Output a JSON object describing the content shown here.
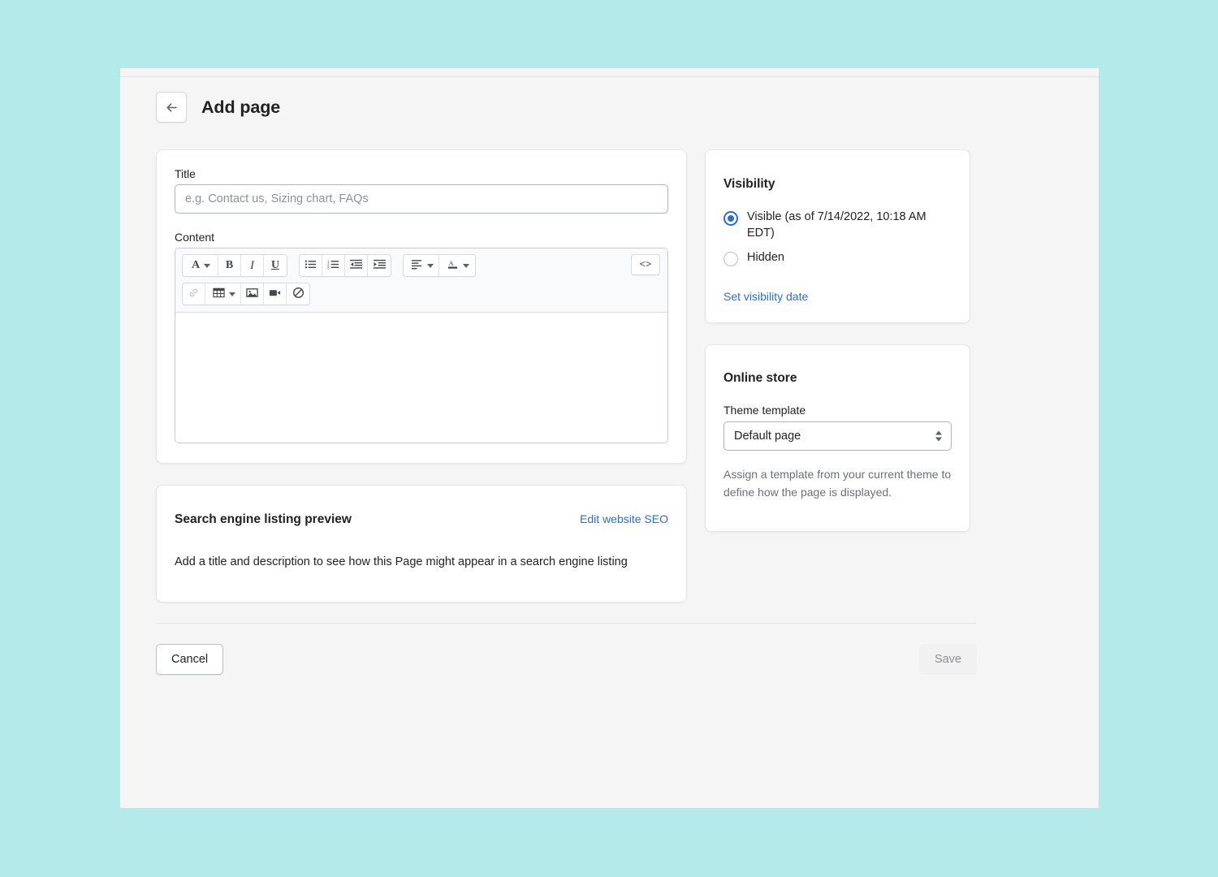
{
  "header": {
    "back_icon": "arrow-left-icon",
    "title": "Add page"
  },
  "form": {
    "title_label": "Title",
    "title_value": "",
    "title_placeholder": "e.g. Contact us, Sizing chart, FAQs",
    "content_label": "Content",
    "content_value": ""
  },
  "editor_toolbar": {
    "row1": [
      {
        "name": "font-format-button",
        "glyph": "A",
        "style": "serifA",
        "caret": true,
        "disabled": false
      },
      {
        "name": "bold-button",
        "glyph": "B",
        "style": "bold",
        "caret": false,
        "disabled": false
      },
      {
        "name": "italic-button",
        "glyph": "I",
        "style": "ital",
        "caret": false,
        "disabled": false
      },
      {
        "name": "underline-button",
        "glyph": "U",
        "style": "und",
        "caret": false,
        "disabled": false
      },
      {
        "name": "bulleted-list-button",
        "glyph": "bulleted-list-icon",
        "style": "icon",
        "caret": false,
        "disabled": false
      },
      {
        "name": "numbered-list-button",
        "glyph": "numbered-list-icon",
        "style": "icon",
        "caret": false,
        "disabled": false
      },
      {
        "name": "outdent-button",
        "glyph": "outdent-icon",
        "style": "icon",
        "caret": false,
        "disabled": false
      },
      {
        "name": "indent-button",
        "glyph": "indent-icon",
        "style": "icon",
        "caret": false,
        "disabled": false
      },
      {
        "name": "align-button",
        "glyph": "align-left-icon",
        "style": "icon",
        "caret": true,
        "disabled": false
      },
      {
        "name": "text-color-button",
        "glyph": "text-color-icon",
        "style": "icon",
        "caret": true,
        "disabled": false
      }
    ],
    "row2": [
      {
        "name": "insert-link-button",
        "glyph": "link-icon",
        "style": "icon",
        "caret": false,
        "disabled": true
      },
      {
        "name": "insert-table-button",
        "glyph": "table-icon",
        "style": "icon",
        "caret": true,
        "disabled": false
      },
      {
        "name": "insert-image-button",
        "glyph": "image-icon",
        "style": "icon",
        "caret": false,
        "disabled": false
      },
      {
        "name": "insert-video-button",
        "glyph": "video-icon",
        "style": "icon",
        "caret": false,
        "disabled": false
      },
      {
        "name": "clear-formatting-button",
        "glyph": "clear-formatting-icon",
        "style": "icon",
        "caret": false,
        "disabled": false
      }
    ],
    "code_button_label": "<>",
    "code_button_name": "show-html-button"
  },
  "seo": {
    "title": "Search engine listing preview",
    "edit_link": "Edit website SEO",
    "body": "Add a title and description to see how this Page might appear in a search engine listing"
  },
  "visibility": {
    "title": "Visibility",
    "options": [
      {
        "label": "Visible (as of 7/14/2022, 10:18 AM EDT)",
        "checked": true
      },
      {
        "label": "Hidden",
        "checked": false
      }
    ],
    "set_date_link": "Set visibility date"
  },
  "online_store": {
    "title": "Online store",
    "template_label": "Theme template",
    "template_value": "Default page",
    "help_text": "Assign a template from your current theme to define how the page is displayed."
  },
  "footer": {
    "cancel_label": "Cancel",
    "save_label": "Save"
  },
  "colors": {
    "accent": "#2c6ecb",
    "page_bg": "#f5f5f5",
    "outer_bg": "#b5eaea",
    "text": "#202223",
    "muted": "#6d7175"
  }
}
